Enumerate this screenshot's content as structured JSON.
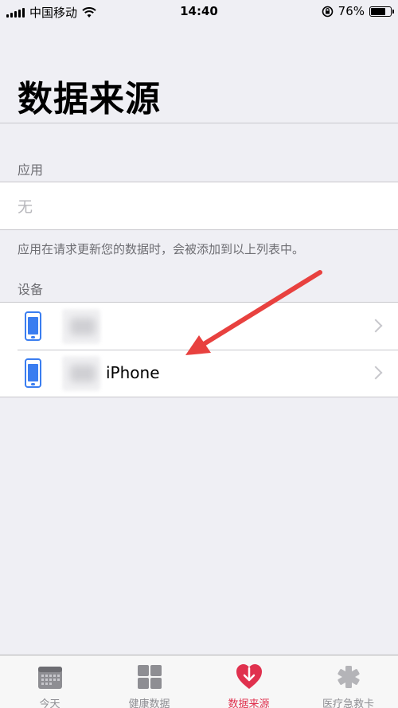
{
  "status_bar": {
    "carrier": "中国移动",
    "time": "14:40",
    "battery_percent": "76%",
    "battery_level": 0.76,
    "icons": [
      "signal-icon",
      "wifi-icon",
      "rotation-lock-icon",
      "battery-icon"
    ]
  },
  "page": {
    "title": "数据来源"
  },
  "apps_section": {
    "header": "应用",
    "empty_text": "无",
    "footer": "应用在请求更新您的数据时，会被添加到以上列表中。"
  },
  "devices_section": {
    "header": "设备",
    "items": [
      {
        "name": "",
        "icon": "iphone-icon"
      },
      {
        "name": "iPhone",
        "icon": "iphone-icon"
      }
    ]
  },
  "tab_bar": {
    "tabs": [
      {
        "label": "今天",
        "icon": "calendar-icon",
        "active": false
      },
      {
        "label": "健康数据",
        "icon": "grid-icon",
        "active": false
      },
      {
        "label": "数据来源",
        "icon": "heart-download-icon",
        "active": true
      },
      {
        "label": "医疗急救卡",
        "icon": "medical-id-icon",
        "active": false
      }
    ]
  },
  "colors": {
    "accent": "#e0314e",
    "device_blue": "#3a7df0",
    "annotation_arrow": "#e8413f",
    "background": "#efeff4"
  }
}
